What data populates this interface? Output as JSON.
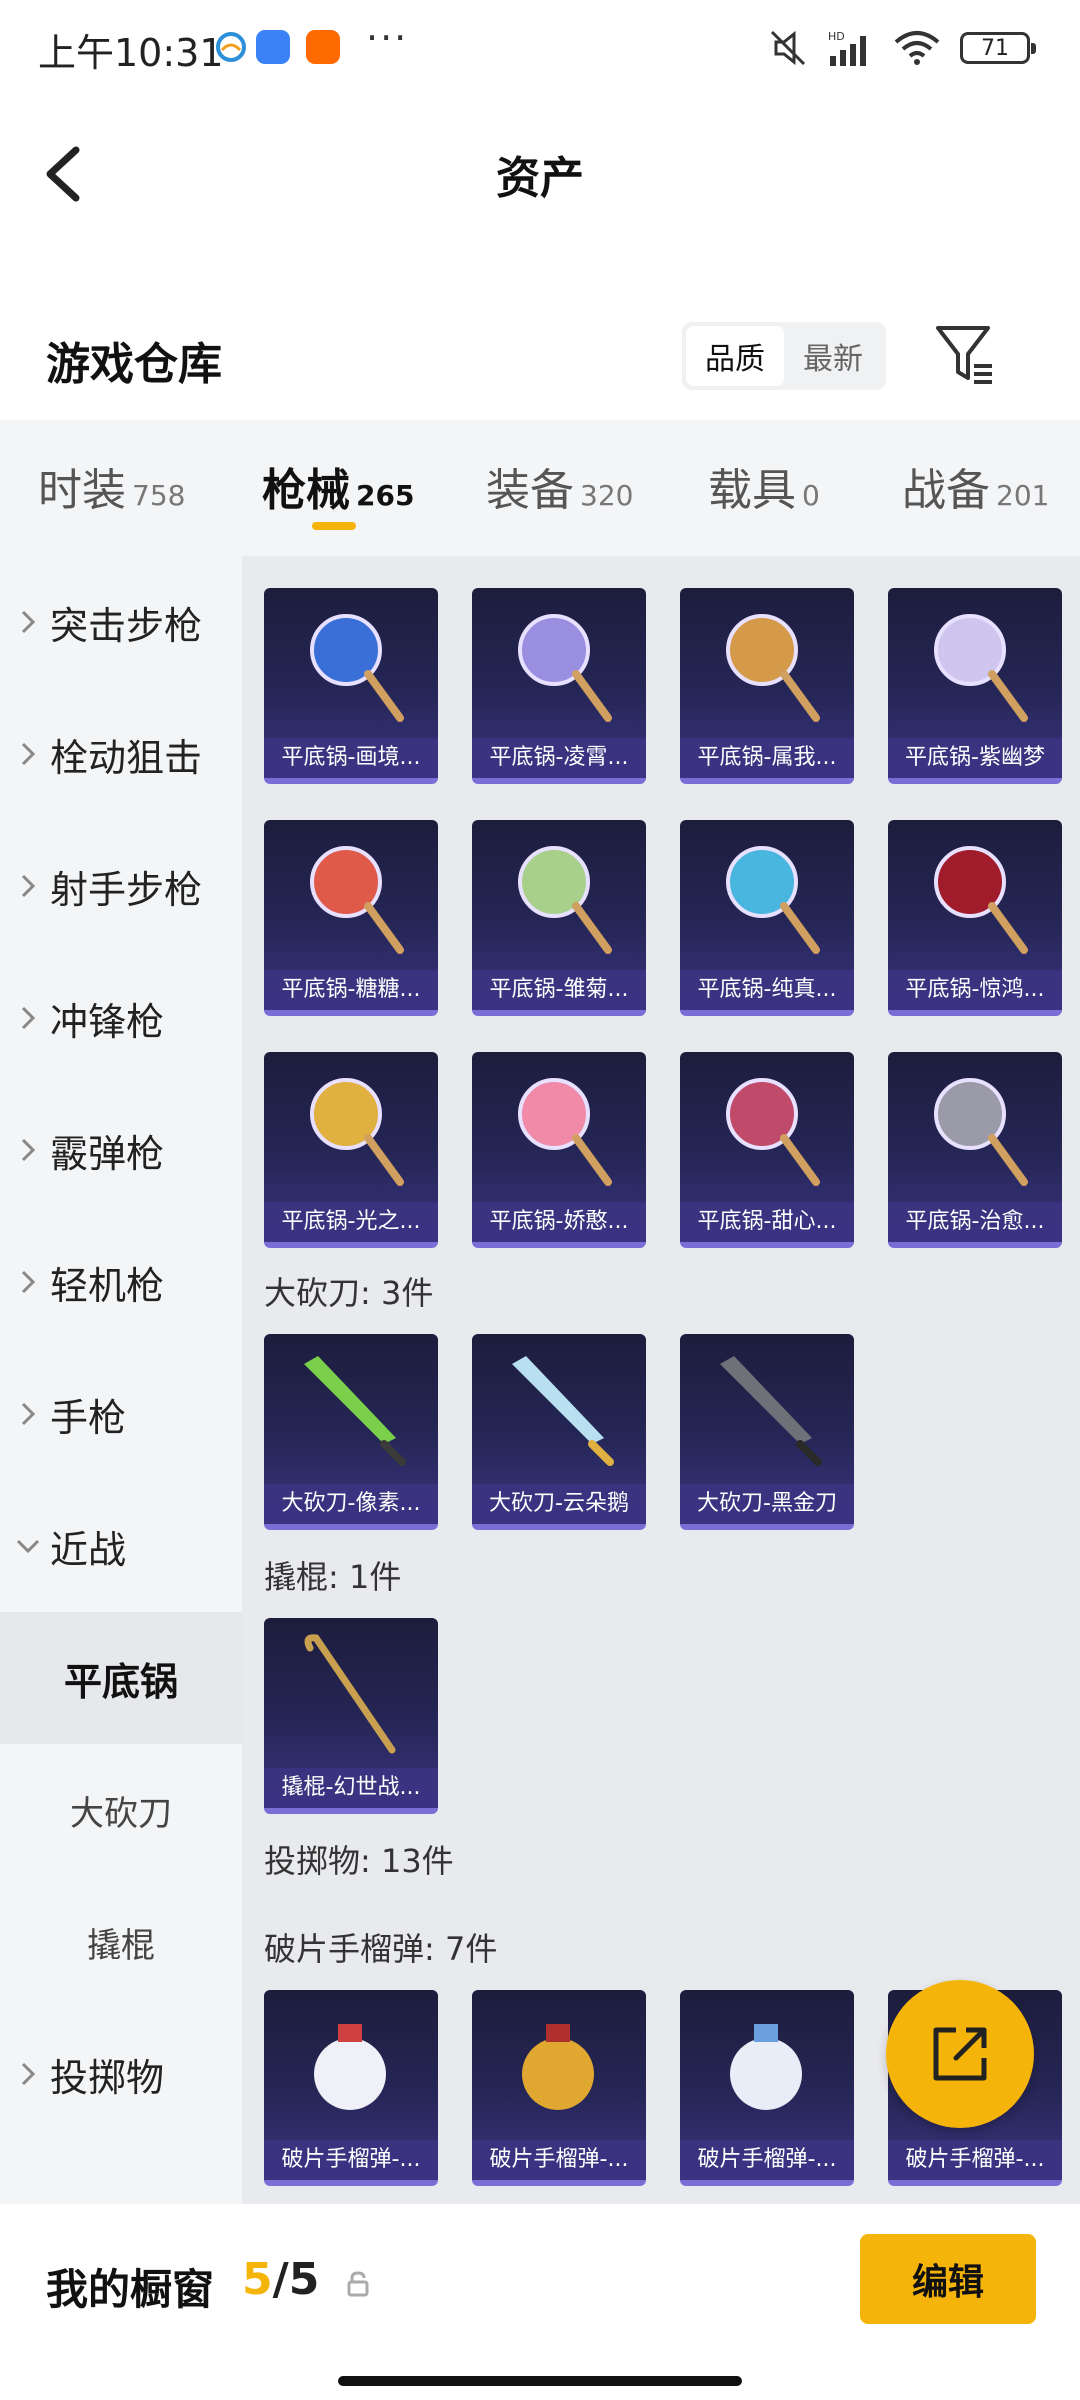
{
  "status_bar": {
    "time": "上午10:31",
    "dots": "···",
    "battery": "71",
    "network": "HD"
  },
  "header": {
    "title": "资产"
  },
  "warehouse": {
    "title": "游戏仓库",
    "sort_options": [
      "品质",
      "最新"
    ],
    "selected_sort": "品质"
  },
  "tabs": [
    {
      "label": "时装",
      "count": "758"
    },
    {
      "label": "枪械",
      "count": "265"
    },
    {
      "label": "装备",
      "count": "320"
    },
    {
      "label": "载具",
      "count": "0"
    },
    {
      "label": "战备",
      "count": "201"
    }
  ],
  "active_tab": "枪械",
  "sidebar": {
    "items": [
      {
        "label": "突击步枪"
      },
      {
        "label": "栓动狙击"
      },
      {
        "label": "射手步枪"
      },
      {
        "label": "冲锋枪"
      },
      {
        "label": "霰弹枪"
      },
      {
        "label": "轻机枪"
      },
      {
        "label": "手枪"
      },
      {
        "label": "近战"
      }
    ],
    "subitems": [
      {
        "label": "平底锅"
      },
      {
        "label": "大砍刀"
      },
      {
        "label": "撬棍"
      }
    ],
    "last_item": {
      "label": "投掷物"
    }
  },
  "content": {
    "pans": [
      {
        "name": "平底锅-画境...",
        "color": "#3a6fd8"
      },
      {
        "name": "平底锅-凌霄...",
        "color": "#9a8ee0"
      },
      {
        "name": "平底锅-属我...",
        "color": "#d49a4a"
      },
      {
        "name": "平底锅-紫幽梦",
        "color": "#cfc6f0"
      },
      {
        "name": "平底锅-糖糖...",
        "color": "#e05a4a"
      },
      {
        "name": "平底锅-雏菊...",
        "color": "#a8d08a"
      },
      {
        "name": "平底锅-纯真...",
        "color": "#49b6e0"
      },
      {
        "name": "平底锅-惊鸿...",
        "color": "#a01c2a"
      },
      {
        "name": "平底锅-光之...",
        "color": "#e0b040"
      },
      {
        "name": "平底锅-娇憨...",
        "color": "#f08aa8"
      },
      {
        "name": "平底锅-甜心...",
        "color": "#c04a6a"
      },
      {
        "name": "平底锅-治愈...",
        "color": "#9a9aa8"
      }
    ],
    "machete_group": "大砍刀: 3件",
    "machetes": [
      {
        "name": "大砍刀-像素...",
        "color": "#7ad04a"
      },
      {
        "name": "大砍刀-云朵鹅",
        "color": "#b8e0f0"
      },
      {
        "name": "大砍刀-黑金刀",
        "color": "#707078"
      }
    ],
    "crowbar_group": "撬棍: 1件",
    "crowbars": [
      {
        "name": "撬棍-幻世战...",
        "color": "#c8a050"
      }
    ],
    "throwables_group": "投掷物: 13件",
    "grenade_group": "破片手榴弹: 7件",
    "grenades": [
      {
        "name": "破片手榴弹-...",
        "color": "#f0f0f8"
      },
      {
        "name": "破片手榴弹-...",
        "color": "#e0a830"
      },
      {
        "name": "破片手榴弹-...",
        "color": "#e8eef8"
      },
      {
        "name": "破片手榴弹-...",
        "color": "#8ab0e0"
      }
    ]
  },
  "bottom_bar": {
    "showcase_label": "我的橱窗",
    "count_current": "5",
    "count_separator": "/",
    "count_total": "5",
    "edit_label": "编辑"
  },
  "colors": {
    "accent": "#f5b40a",
    "card_bg": "#262657"
  },
  "icons": {
    "back": "chevron-left-icon",
    "filter": "filter-icon",
    "share": "share-external-icon",
    "lock": "lock-icon"
  }
}
